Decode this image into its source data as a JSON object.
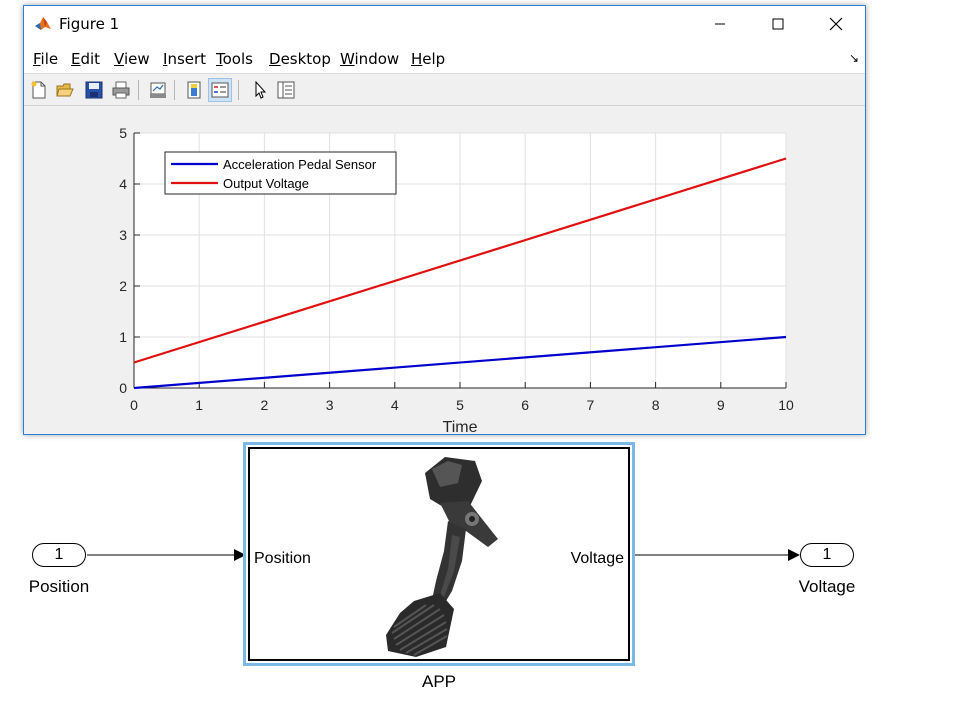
{
  "window": {
    "title": "Figure 1",
    "controls": [
      "minimize",
      "maximize",
      "close"
    ]
  },
  "menu": [
    {
      "label": "File"
    },
    {
      "label": "Edit"
    },
    {
      "label": "View"
    },
    {
      "label": "Insert"
    },
    {
      "label": "Tools"
    },
    {
      "label": "Desktop"
    },
    {
      "label": "Window"
    },
    {
      "label": "Help"
    }
  ],
  "toolbar": [
    {
      "icon": "new-figure-icon"
    },
    {
      "icon": "open-file-icon"
    },
    {
      "icon": "save-icon"
    },
    {
      "icon": "print-icon"
    },
    {
      "icon": "link-plot-icon"
    },
    {
      "icon": "insert-colorbar-icon"
    },
    {
      "icon": "insert-legend-icon",
      "pressed": true
    },
    {
      "icon": "edit-plot-pointer-icon"
    },
    {
      "icon": "property-inspector-icon"
    }
  ],
  "chart_data": {
    "type": "line",
    "title": "",
    "xlabel": "Time",
    "ylabel": "",
    "xlim": [
      0,
      10
    ],
    "ylim": [
      0,
      5
    ],
    "xticks": [
      0,
      1,
      2,
      3,
      4,
      5,
      6,
      7,
      8,
      9,
      10
    ],
    "yticks": [
      0,
      1,
      2,
      3,
      4,
      5
    ],
    "grid": true,
    "legend_position": "top-left",
    "series": [
      {
        "name": "Acceleration Pedal Sensor",
        "color": "#0000cc",
        "x": [
          0,
          10
        ],
        "y": [
          0,
          1
        ]
      },
      {
        "name": "Output Voltage",
        "color": "#e01010",
        "x": [
          0,
          10
        ],
        "y": [
          0.5,
          4.5
        ]
      }
    ]
  },
  "diagram": {
    "inport": {
      "number": "1",
      "label": "Position"
    },
    "outport": {
      "number": "1",
      "label": "Voltage"
    },
    "block": {
      "name": "APP",
      "input_label": "Position",
      "output_label": "Voltage",
      "image": "accelerator-pedal-image"
    }
  }
}
